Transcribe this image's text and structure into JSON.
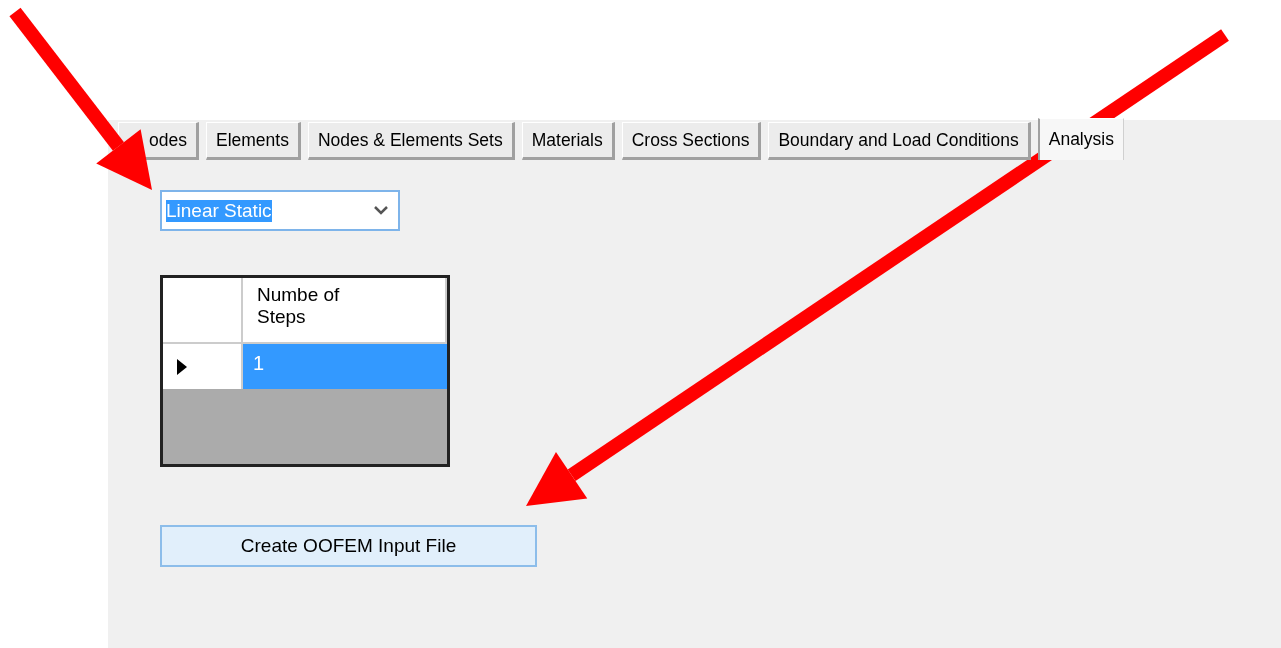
{
  "tabs": [
    {
      "label": "odes",
      "selected": false
    },
    {
      "label": "Elements",
      "selected": false
    },
    {
      "label": "Nodes & Elements Sets",
      "selected": false
    },
    {
      "label": "Materials",
      "selected": false
    },
    {
      "label": "Cross Sections",
      "selected": false
    },
    {
      "label": "Boundary and Load Conditions",
      "selected": false
    },
    {
      "label": "Analysis",
      "selected": true
    }
  ],
  "analysis_type": {
    "value": "Linear Static"
  },
  "table": {
    "columns": [
      "Numbe of Steps"
    ],
    "rows": [
      {
        "current": true,
        "selected": true,
        "cells": [
          "1"
        ]
      }
    ]
  },
  "create_button": {
    "label": "Create OOFEM Input File"
  }
}
